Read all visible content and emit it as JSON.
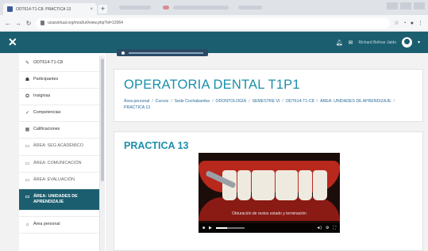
{
  "browser": {
    "tab_title": "ODT614-T1-C8: PRACTICA 13",
    "url": "ucasvirtual.org/mod/url/view.php?id=12064"
  },
  "navbar": {
    "user_name": "Richard Bolívar Jaldo"
  },
  "drawer": {
    "items": [
      {
        "label": "ODT614-T1-C8",
        "icon": "graduation-cap-icon",
        "glyph": "✎"
      },
      {
        "label": "Participantes",
        "icon": "users-icon",
        "glyph": "☗"
      },
      {
        "label": "Insignias",
        "icon": "badge-icon",
        "glyph": "✪"
      },
      {
        "label": "Competencias",
        "icon": "check-icon",
        "glyph": "✓"
      },
      {
        "label": "Calificaciones",
        "icon": "table-icon",
        "glyph": "▦"
      },
      {
        "label": "ÁREA: SEG ACADÉMICO",
        "icon": "folder-icon",
        "glyph": "▭"
      },
      {
        "label": "ÁREA: COMUNICACIÓN",
        "icon": "folder-icon",
        "glyph": "▭"
      },
      {
        "label": "ÁREA: EVALUACIÓN",
        "icon": "folder-icon",
        "glyph": "▭"
      },
      {
        "label": "ÁREA: UNIDADES DE APRENDIZAJE",
        "icon": "folder-icon",
        "glyph": "▭"
      },
      {
        "label": "Área personal",
        "icon": "home-icon",
        "glyph": "⌂"
      }
    ]
  },
  "header": {
    "course_title": "OPERATORIA DENTAL T1P1",
    "breadcrumb": [
      "Área personal",
      "Cursos",
      "Sede Cochabamba",
      "ODONTOLOGÍA",
      "SEMESTRE VI",
      "ODT614-T1-C8",
      "ÁREA: UNIDADES DE APRENDIZAJE",
      "PRACTICA 13"
    ]
  },
  "content": {
    "page_title": "PRACTICA 13",
    "video": {
      "caption": "Obturación de restos estado y terminación",
      "progress_percent": 40
    }
  }
}
